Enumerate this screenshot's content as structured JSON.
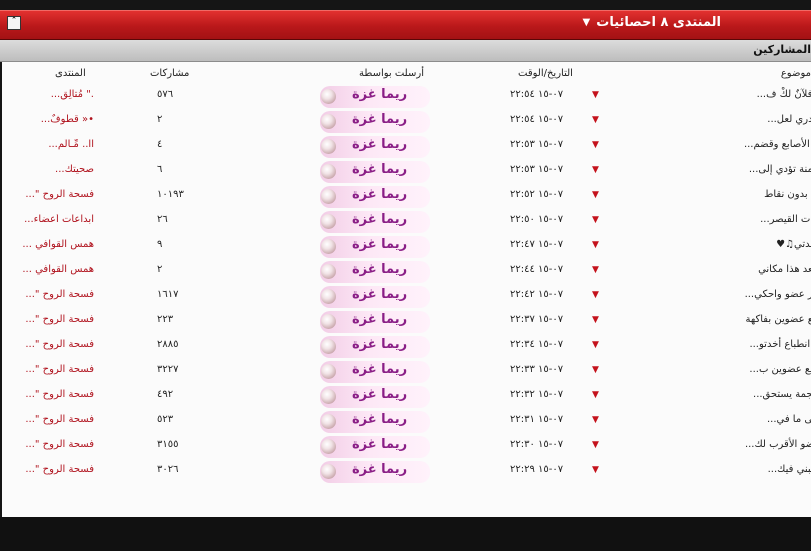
{
  "header": {
    "title": "المنتدى ٨ احصائيات",
    "collapse_icon": "double-chevron-up-icon",
    "dropdown_icon": "caret-down-icon"
  },
  "subheader": {
    "label": "المشاركين"
  },
  "table": {
    "columns": {
      "topic": "موضوع",
      "date": "التاريخ/الوقت",
      "poster": "أرسلت بواسطة",
      "posts": "مشاركات",
      "forum": "المنتدى"
    },
    "rows": [
      {
        "topic": "ب فلآنٌ لكْ ف...",
        "date": "٠٧-١٥ ٢٢:٥٤",
        "poster": "ريما غزة",
        "posts": "٥٧٦",
        "forum": ".\" مُتأَلِق..."
      },
      {
        "topic": "لا تدري لعل...",
        "date": "٠٧-١٥ ٢٢:٥٤",
        "poster": "ريما غزة",
        "posts": "٢",
        "forum": "•« قطوفٌ..."
      },
      {
        "topic": "ص الأصابع وقضم...",
        "date": "٠٧-١٥ ٢٢:٥٣",
        "poster": "ريما غزة",
        "posts": "٤",
        "forum": "اا.. مِّـآلَم..."
      },
      {
        "topic": "بسمنة تؤدي إلى...",
        "date": "٠٧-١٥ ٢٢:٥٣",
        "poster": "ريما غزة",
        "posts": "٦",
        "forum": "صحيتك..."
      },
      {
        "topic": "لمة بدون نقاط",
        "date": "٠٧-١٥ ٢٢:٥٢",
        "poster": "ريما غزة",
        "posts": "١٠١٩٣",
        "forum": "فسحة الروح \"..."
      },
      {
        "topic": "نائيات القيصر...",
        "date": "٠٧-١٥ ٢٢:٥٠",
        "poster": "ريما غزة",
        "posts": "٢٦",
        "forum": "ابداعات أعضاء..."
      },
      {
        "topic": "بيـــدتي♫♥",
        "date": "٠٧-١٥ ٢٢:٤٧",
        "poster": "ريما غزة",
        "posts": "٩",
        "forum": "همس القوافي ..."
      },
      {
        "topic": "م بعد هذا مكاني",
        "date": "٠٧-١٥ ٢٢:٤٤",
        "poster": "ريما غزة",
        "posts": "٢",
        "forum": "همس القوافي ..."
      },
      {
        "topic": "ختار عضو واحكي...",
        "date": "٠٧-١٥ ٢٢:٤٢",
        "poster": "ريما غزة",
        "posts": "١٦١٧",
        "forum": "فسحة الروح \"..."
      },
      {
        "topic": "جمع عضوين بفاكهة",
        "date": "٠٧-١٥ ٢٢:٣٧",
        "poster": "ريما غزة",
        "posts": "٢٢٣",
        "forum": "فسحة الروح \"..."
      },
      {
        "topic": "خر انطباع أخدتو...",
        "date": "٠٧-١٥ ٢٢:٣٤",
        "poster": "ريما غزة",
        "posts": "٢٨٨٥",
        "forum": "فسحة الروح \"..."
      },
      {
        "topic": "أجمع عضوين ب...",
        "date": "٠٧-١٥ ٢٢:٣٣",
        "poster": "ريما غزة",
        "posts": "٣٢٢٧",
        "forum": "فسحة الروح \"..."
      },
      {
        "topic": "م نجمة يستحق...",
        "date": "٠٧-١٥ ٢٢:٣٢",
        "poster": "ريما غزة",
        "posts": "٤٩٢",
        "forum": "فسحة الروح \"..."
      },
      {
        "topic": "احلى ما في...",
        "date": "٠٧-١٥ ٢٢:٣١",
        "poster": "ريما غزة",
        "posts": "٥٢٣",
        "forum": "فسحة الروح \"..."
      },
      {
        "topic": "العضو الأقرب لك...",
        "date": "٠٧-١٥ ٢٢:٣٠",
        "poster": "ريما غزة",
        "posts": "٣١٥٥",
        "forum": "فسحة الروح \"..."
      },
      {
        "topic": "يعجبني فيك...",
        "date": "٠٧-١٥ ٢٢:٢٩",
        "poster": "ريما غزة",
        "posts": "٣٠٢٦",
        "forum": "فسحة الروح \"..."
      }
    ]
  },
  "colors": {
    "header_red": "#c41d1e",
    "forum_link": "#b0121d",
    "poster_name": "#8a1e86",
    "row_arrow": "#c4121c"
  }
}
